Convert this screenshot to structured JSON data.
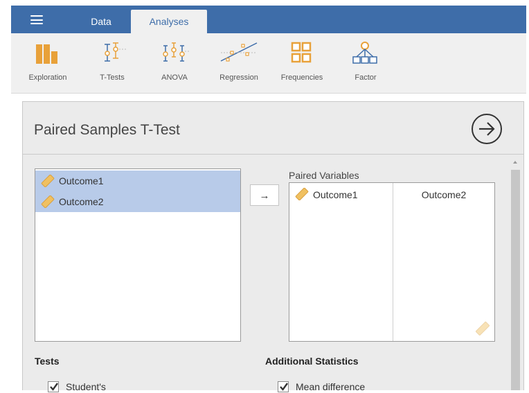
{
  "topbar": {
    "tabs": [
      {
        "label": "Data",
        "active": false
      },
      {
        "label": "Analyses",
        "active": true
      }
    ]
  },
  "ribbon": {
    "items": [
      {
        "label": "Exploration",
        "icon": "exploration-icon"
      },
      {
        "label": "T-Tests",
        "icon": "t-tests-icon"
      },
      {
        "label": "ANOVA",
        "icon": "anova-icon"
      },
      {
        "label": "Regression",
        "icon": "regression-icon"
      },
      {
        "label": "Frequencies",
        "icon": "frequencies-icon"
      },
      {
        "label": "Factor",
        "icon": "factor-icon"
      }
    ]
  },
  "panel": {
    "title": "Paired Samples T-Test",
    "run_icon": "arrow-circle-icon",
    "variables": [
      {
        "name": "Outcome1",
        "selected": true,
        "icon": "ruler-icon"
      },
      {
        "name": "Outcome2",
        "selected": true,
        "icon": "ruler-icon"
      }
    ],
    "move_label": "→",
    "paired_label": "Paired Variables",
    "pairs": [
      {
        "left": "Outcome1",
        "right": "Outcome2"
      }
    ],
    "tests_title": "Tests",
    "tests": [
      {
        "label": "Student's",
        "checked": true
      }
    ],
    "additional_title": "Additional Statistics",
    "additional": [
      {
        "label": "Mean difference",
        "checked": true
      }
    ]
  },
  "colors": {
    "topbar": "#3e6da9",
    "ribbon_icon": "#e8a13a",
    "ribbon_accent": "#3e6da9",
    "selection": "#b8cbe9",
    "panel_bg": "#ebebeb"
  }
}
